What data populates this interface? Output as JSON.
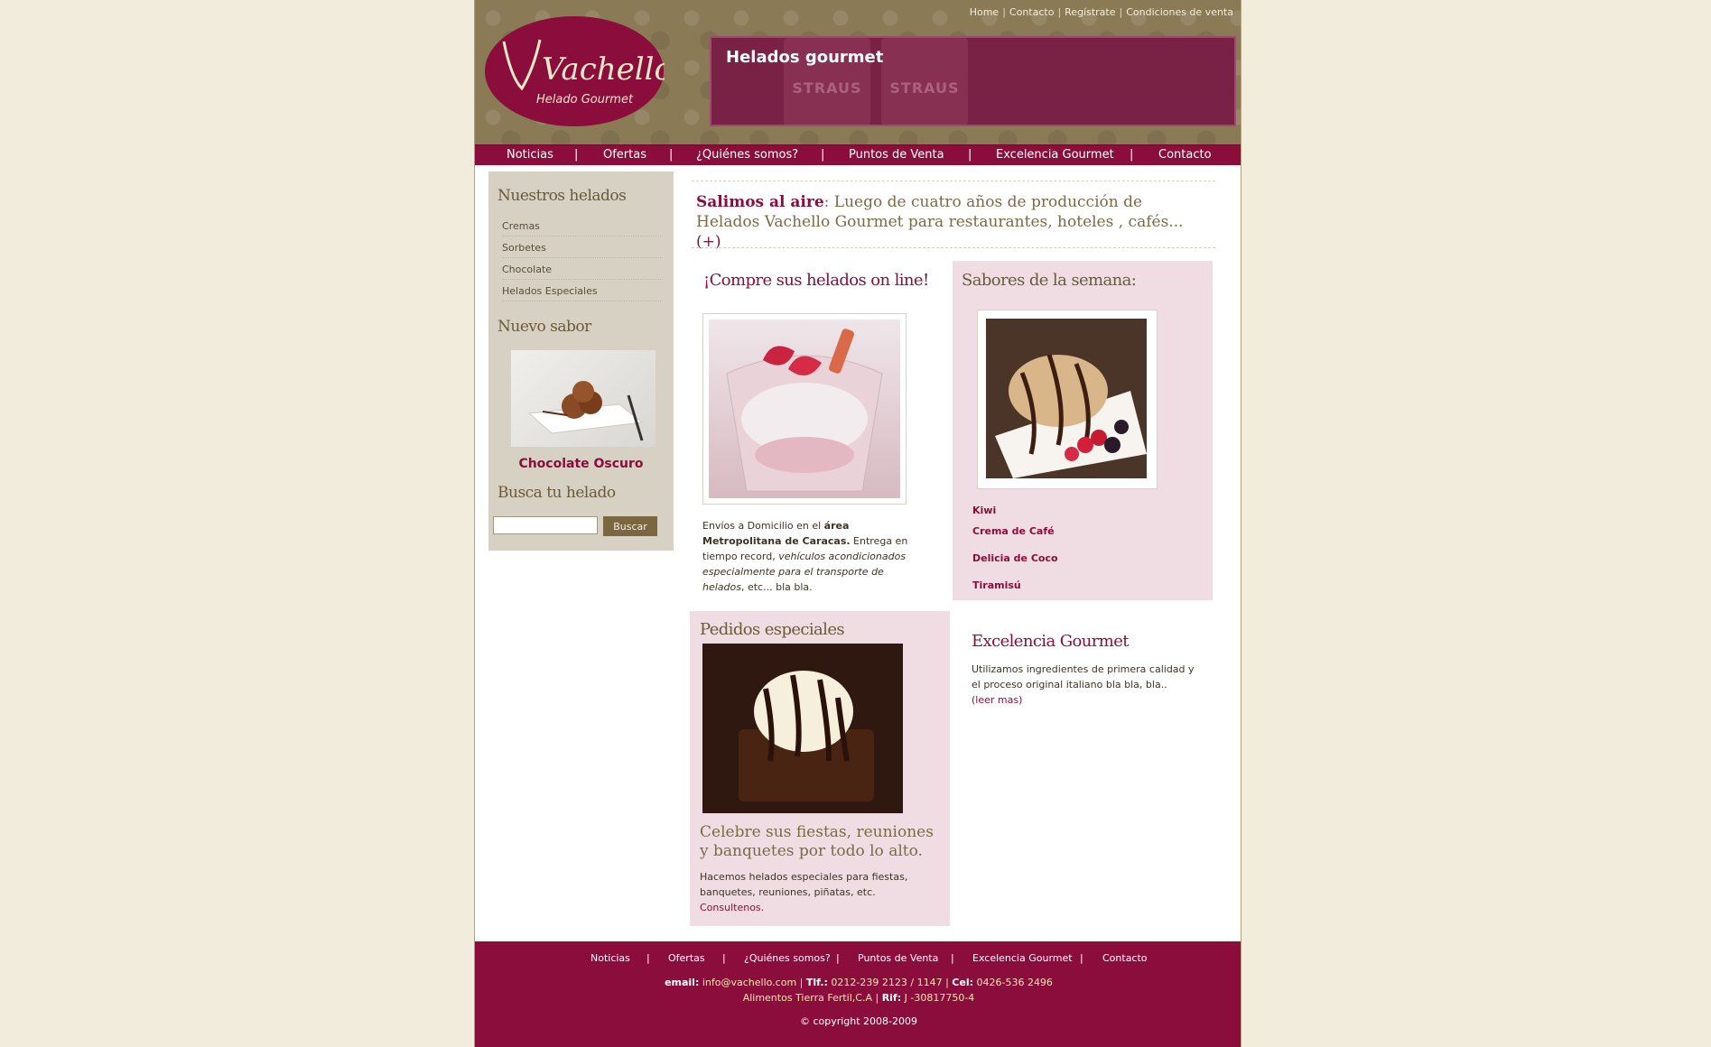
{
  "top_links": [
    "Home",
    "Contacto",
    "Regístrate",
    "Condiciones de venta"
  ],
  "logo": {
    "name": "Vachello",
    "tagline": "Helado Gourmet"
  },
  "banner": {
    "title": "Helados gourmet",
    "cup_text": "STRAUS"
  },
  "nav": [
    "Noticias",
    "Ofertas",
    "¿Quiénes somos?",
    "Puntos de Venta",
    "Excelencia Gourmet",
    "Contacto"
  ],
  "sidebar": {
    "helados_title": "Nuestros helados",
    "items": [
      "Cremas",
      "Sorbetes",
      "Chocolate",
      "Helados Especiales"
    ],
    "nuevo_title": "Nuevo sabor",
    "product_name": "Chocolate Oscuro",
    "search_title": "Busca tu helado",
    "search_placeholder": "",
    "search_button": "Buscar"
  },
  "intro": {
    "bold": "Salimos al aire",
    "text": ": Luego de cuatro años de producción de Helados Vachello Gourmet para restaurantes, hoteles , cafés...",
    "more": "(+)"
  },
  "compre": {
    "title": "¡Compre sus helados on line!",
    "text1": "Envíos a Domicilio en el ",
    "bold": "área Metropolitana de Caracas.",
    "text2": " Entrega en tiempo record, ",
    "italic": "vehículos acondicionados especialmente para el transporte de helados",
    "text3": ", etc... bla bla."
  },
  "sabores": {
    "title": "Sabores de la semana:",
    "items": [
      "Kiwi",
      "Crema de Café",
      "Delicia de Coco",
      "Tiramisú"
    ]
  },
  "pedidos": {
    "title": "Pedidos especiales",
    "subtitle": "Celebre sus fiestas, reuniones y banquetes por todo lo alto.",
    "text": "Hacemos helados especiales para fiestas, banquetes, reuniones, piñatas, etc.",
    "link": "Consultenos."
  },
  "excelencia": {
    "title": "Excelencia Gourmet",
    "text": "Utilizamos ingredientes de primera calidad y el proceso original italiano bla bla, bla..",
    "link": "(leer mas)"
  },
  "footer": {
    "nav": [
      "Noticias",
      "Ofertas",
      "¿Quiénes somos?",
      "Puntos de Venta",
      "Excelencia Gourmet",
      "Contacto"
    ],
    "email_label": "email:",
    "email": "info@vachello.com",
    "tlf_label": "Tlf.:",
    "tlf": "0212-239 2123 / 1147",
    "cel_label": "Cel:",
    "cel": "0426-536 2496",
    "company": "Alimentos Tierra Fertil,C.A",
    "rif_label": "Rif:",
    "rif": "J -30817750-4",
    "copyright": "© copyright 2008-2009"
  },
  "colors": {
    "brand": "#8b0d3b",
    "olive": "#8a7a56",
    "pink_box": "#efdde3",
    "sidebar": "#d6d1c3"
  }
}
